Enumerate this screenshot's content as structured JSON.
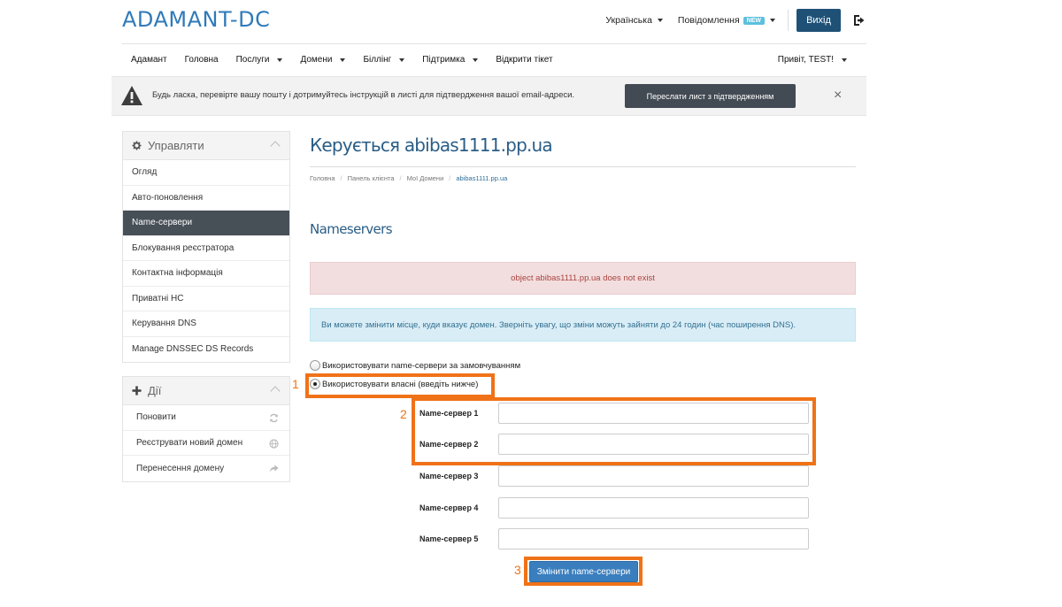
{
  "header": {
    "brand": "ADAMANT-DC",
    "language": "Українська",
    "notifications": "Повідомлення",
    "notifications_badge": "NEW",
    "logout": "Вихід"
  },
  "nav": {
    "items": [
      {
        "label": "Адамант",
        "dropdown": false
      },
      {
        "label": "Головна",
        "dropdown": false
      },
      {
        "label": "Послуги",
        "dropdown": true
      },
      {
        "label": "Домени",
        "dropdown": true
      },
      {
        "label": "Біллінг",
        "dropdown": true
      },
      {
        "label": "Підтримка",
        "dropdown": true
      },
      {
        "label": "Відкрити тікет",
        "dropdown": false
      }
    ],
    "greeting": "Привіт, TEST!"
  },
  "verify_bar": {
    "text": "Будь ласка, перевірте вашу пошту і дотримуйтесь інструкцій в листі для підтвердження вашої email-адреси.",
    "button": "Переслати лист з підтвердженням",
    "close": "×"
  },
  "sidebar": {
    "manage_title": "Управляти",
    "manage_items": [
      {
        "label": "Огляд",
        "active": false
      },
      {
        "label": "Авто-поновлення",
        "active": false
      },
      {
        "label": "Name-сервери",
        "active": true
      },
      {
        "label": "Блокування реєстратора",
        "active": false
      },
      {
        "label": "Контактна інформація",
        "active": false
      },
      {
        "label": "Приватні НС",
        "active": false
      },
      {
        "label": "Керування DNS",
        "active": false
      },
      {
        "label": "Manage DNSSEC DS Records",
        "active": false
      }
    ],
    "actions_title": "Дії",
    "action_items": [
      {
        "label": "Поновити",
        "icon": "refresh-icon"
      },
      {
        "label": "Реєструвати новий домен",
        "icon": "globe-icon"
      },
      {
        "label": "Перенесення домену",
        "icon": "share-arrow-icon"
      }
    ]
  },
  "main": {
    "title": "Керується abibas1111.pp.ua",
    "breadcrumb": [
      "Головна",
      "Панель клієнта",
      "Мої Домени",
      "abibas1111.pp.ua"
    ],
    "section_title": "Nameservers",
    "error": "object abibas1111.pp.ua does not exist",
    "info": "Ви можете змінити місце, куди вказує домен. Зверніть увагу, що зміни можуть зайняти до 24 годин (час поширення DNS).",
    "radio_default": "Використовувати name-сервери за замовчуванням",
    "radio_custom": "Використовувати власні (введіть нижче)",
    "ns_labels": [
      "Name-сервер 1",
      "Name-сервер 2",
      "Name-сервер 3",
      "Name-сервер 4",
      "Name-сервер 5"
    ],
    "ns_values": [
      "",
      "",
      "",
      "",
      ""
    ],
    "submit": "Змінити name-сервери"
  },
  "annotations": {
    "labels": [
      "1",
      "2",
      "3"
    ],
    "color": "#f07218"
  },
  "colors": {
    "brand": "#2f7ab9",
    "active_menu": "#474f57",
    "logout_button": "#1f5177",
    "submit_button": "#3a7ebe"
  }
}
